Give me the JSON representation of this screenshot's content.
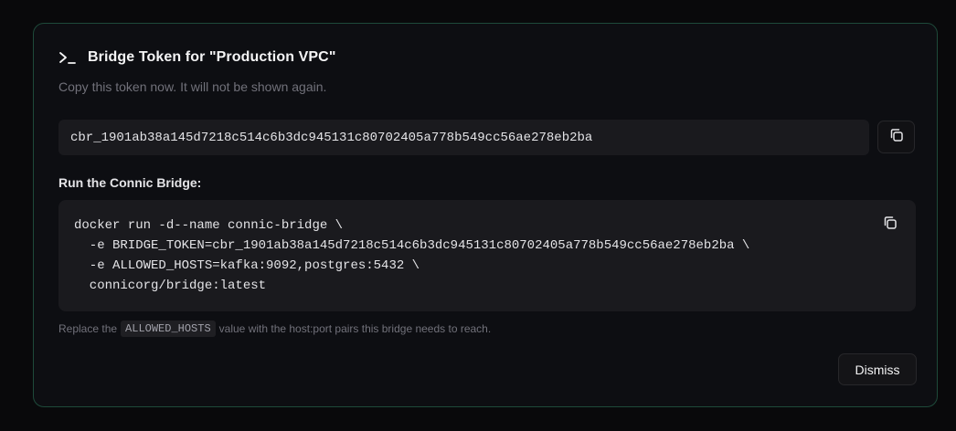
{
  "dialog": {
    "title": "Bridge Token for \"Production VPC\"",
    "subtitle": "Copy this token now. It will not be shown again.",
    "title_icon": "terminal-icon",
    "accent_border": "#1e4a3a"
  },
  "token": {
    "value": "cbr_1901ab38a145d7218c514c6b3dc945131c80702405a778b549cc56ae278eb2ba",
    "copy_icon": "copy-icon"
  },
  "run_section": {
    "label": "Run the Connic Bridge:",
    "code_lines": [
      "docker run -d--name connic-bridge \\",
      "  -e BRIDGE_TOKEN=cbr_1901ab38a145d7218c514c6b3dc945131c80702405a778b549cc56ae278eb2ba \\",
      "  -e ALLOWED_HOSTS=kafka:9092,postgres:5432 \\",
      "  connicorg/bridge:latest"
    ],
    "copy_icon": "copy-icon"
  },
  "note": {
    "before": "Replace the",
    "code": "ALLOWED_HOSTS",
    "after": "value with the host:port pairs this bridge needs to reach."
  },
  "actions": {
    "dismiss_label": "Dismiss"
  }
}
